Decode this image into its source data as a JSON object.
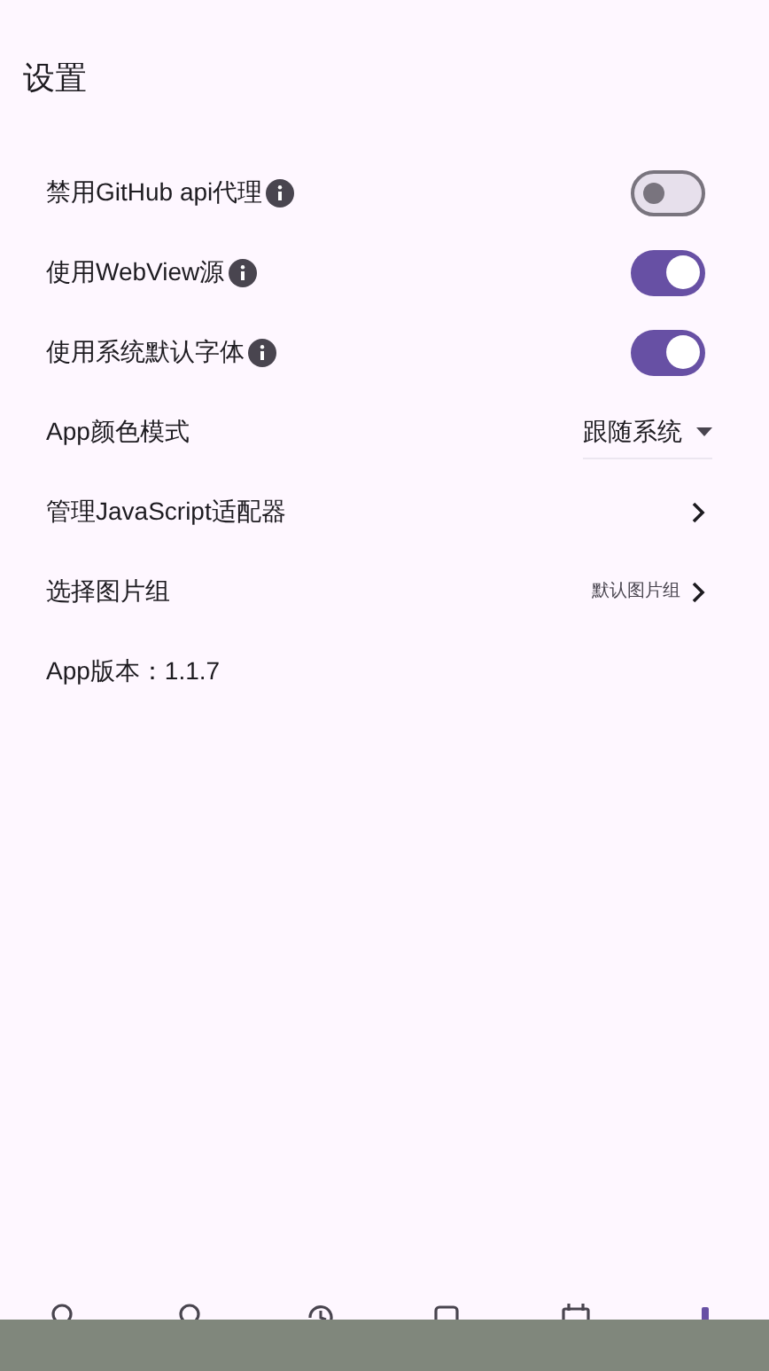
{
  "title": "设置",
  "settings": [
    {
      "kind": "switch",
      "label": "禁用GitHub api代理",
      "info": true,
      "on": false
    },
    {
      "kind": "switch",
      "label": "使用WebView源",
      "info": true,
      "on": true
    },
    {
      "kind": "switch",
      "label": "使用系统默认字体",
      "info": true,
      "on": true
    },
    {
      "kind": "dropdown",
      "label": "App颜色模式",
      "value": "跟随系统"
    },
    {
      "kind": "link",
      "label": "管理JavaScript适配器"
    },
    {
      "kind": "link",
      "label": "选择图片组",
      "value": "默认图片组"
    },
    {
      "kind": "text",
      "label": "App版本：1.1.7"
    }
  ],
  "nav": [
    {
      "selected": false
    },
    {
      "selected": false
    },
    {
      "selected": false
    },
    {
      "selected": false
    },
    {
      "selected": false
    },
    {
      "selected": true
    }
  ]
}
